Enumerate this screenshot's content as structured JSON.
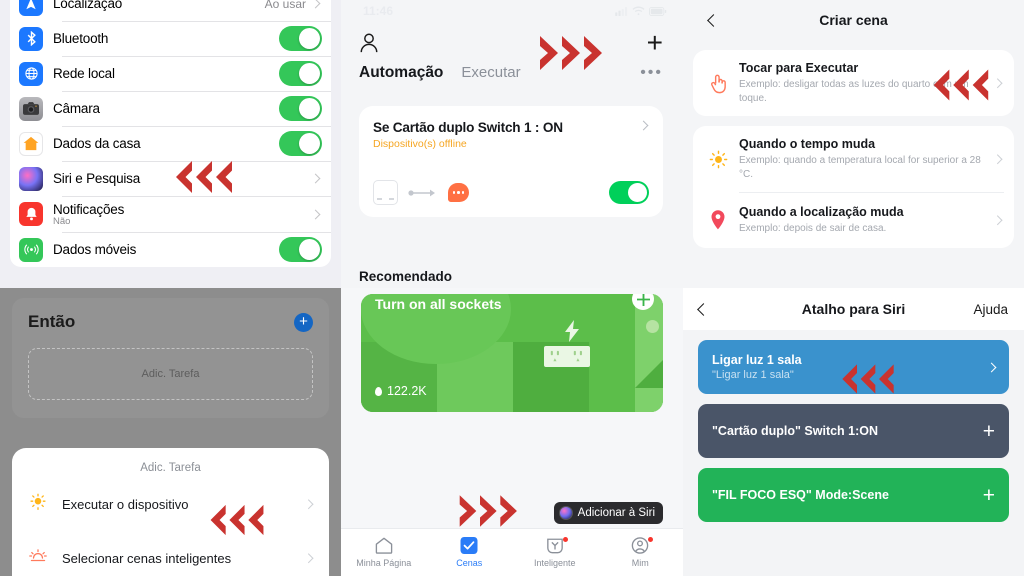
{
  "colors": {
    "arrow_red": "#c9332f",
    "ios_green": "#34c759",
    "ios_blue": "#1c78ff",
    "tab_blue": "#2a7cf7",
    "orange_warning": "#f5a623"
  },
  "panel_settings": {
    "rows": [
      {
        "label": "Localização",
        "value": "Ao usar",
        "icon": "location-icon",
        "control": "chevron"
      },
      {
        "label": "Bluetooth",
        "value": "",
        "icon": "bluetooth-icon",
        "control": "toggle"
      },
      {
        "label": "Rede local",
        "value": "",
        "icon": "local-network-icon",
        "control": "toggle"
      },
      {
        "label": "Câmara",
        "value": "",
        "icon": "camera-icon",
        "control": "toggle"
      },
      {
        "label": "Dados da casa",
        "value": "",
        "icon": "home-icon",
        "control": "toggle"
      },
      {
        "label": "Siri e Pesquisa",
        "value": "",
        "icon": "siri-icon",
        "control": "chevron"
      },
      {
        "label": "Notificações",
        "sub": "Não",
        "value": "",
        "icon": "notifications-icon",
        "control": "chevron"
      },
      {
        "label": "Dados móveis",
        "value": "",
        "icon": "cellular-data-icon",
        "control": "toggle"
      }
    ]
  },
  "panel_automation": {
    "status_time": "11:46",
    "tab_active": "Automação",
    "tab_inactive": "Executar",
    "card": {
      "title": "Se Cartão duplo Switch 1 : ON",
      "status": "Dispositivo(s) offline"
    },
    "section_below": "Recomendado"
  },
  "panel_create_scene": {
    "title": "Criar cena",
    "options": [
      {
        "name": "Tocar para Executar",
        "desc": "Exemplo: desligar todas as luzes do quarto com um toque.",
        "icon": "tap-hand-icon"
      },
      {
        "name": "Quando o tempo muda",
        "desc": "Exemplo: quando a temperatura local for superior a 28 °C.",
        "icon": "sun-icon"
      },
      {
        "name": "Quando a localização muda",
        "desc": "Exemplo: depois de sair de casa.",
        "icon": "pin-icon"
      }
    ]
  },
  "panel_then": {
    "title": "Então",
    "placeholder": "Adic. Tarefa",
    "sheet_title": "Adic. Tarefa",
    "items": [
      {
        "label": "Executar o dispositivo",
        "icon": "bulb-icon"
      },
      {
        "label": "Selecionar cenas inteligentes",
        "icon": "scene-icon"
      }
    ]
  },
  "panel_scenes": {
    "scene_title": "Turn on all sockets",
    "scene_count": "122.2K",
    "siri_button": "Adicionar à Siri",
    "tabs": [
      {
        "label": "Minha Página",
        "icon": "home-outline-icon",
        "active": false,
        "badge": false
      },
      {
        "label": "Cenas",
        "icon": "check-square-icon",
        "active": true,
        "badge": false
      },
      {
        "label": "Inteligente",
        "icon": "smart-icon",
        "active": false,
        "badge": true
      },
      {
        "label": "Mim",
        "icon": "profile-icon",
        "active": false,
        "badge": true
      }
    ]
  },
  "panel_siri_shortcut": {
    "title": "Atalho para Siri",
    "help": "Ajuda",
    "items": [
      {
        "title": "Ligar luz 1 sala",
        "sub": "\"Ligar luz 1 sala\"",
        "color": "#3a92cd",
        "action": "chevron"
      },
      {
        "title": "\"Cartão duplo\" Switch 1:ON",
        "sub": "",
        "color": "#4a5568",
        "action": "plus"
      },
      {
        "title": "\"FIL FOCO ESQ\" Mode:Scene",
        "sub": "",
        "color": "#22b358",
        "action": "plus"
      }
    ]
  }
}
